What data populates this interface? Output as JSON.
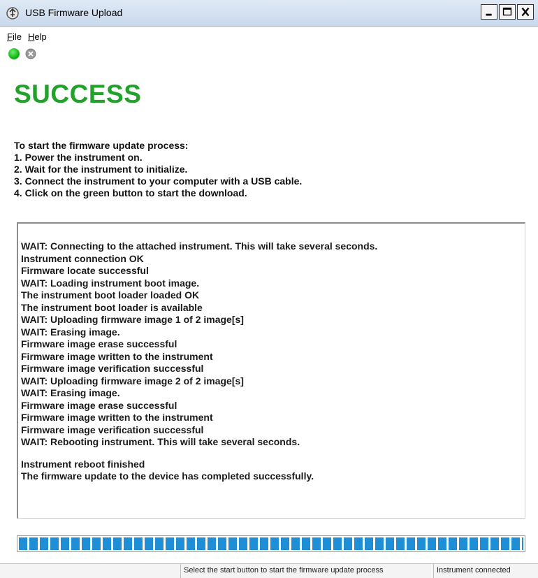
{
  "window": {
    "title": "USB Firmware Upload",
    "icon": "usb-firmware-app-icon",
    "buttons": {
      "minimize": "_",
      "maximize": "□",
      "close": "X"
    }
  },
  "menu": {
    "file": {
      "accel": "F",
      "rest": "ile"
    },
    "help": {
      "accel": "H",
      "rest": "elp"
    }
  },
  "toolbar": {
    "start": {
      "icon": "green-circle-start-icon",
      "color": "#14b414"
    },
    "stop": {
      "icon": "gray-x-circle-stop-icon",
      "color": "#8a8a8a"
    }
  },
  "status_heading": {
    "text": "SUCCESS",
    "color": "#22a22a"
  },
  "instructions": {
    "intro": "To start the firmware update process:",
    "steps": [
      "1. Power the instrument on.",
      "2. Wait for the instrument to initialize.",
      "3. Connect the instrument to your computer with a USB cable.",
      "4. Click on the green button to start the download."
    ]
  },
  "log": {
    "lines": [
      "WAIT: Connecting to the attached instrument. This will take several seconds.",
      "Instrument connection OK",
      "Firmware locate successful",
      "WAIT: Loading instrument boot image.",
      "The instrument boot loader loaded OK",
      "The instrument boot loader is available",
      "WAIT: Uploading firmware image 1 of 2 image[s]",
      "WAIT: Erasing image.",
      "Firmware image erase successful",
      "Firmware image written to the instrument",
      "Firmware image verification successful",
      "WAIT: Uploading firmware image 2 of 2 image[s]",
      "WAIT: Erasing image.",
      "Firmware image erase successful",
      "Firmware image written to the instrument",
      "Firmware image verification successful",
      "WAIT: Rebooting instrument. This will take several seconds."
    ],
    "final_lines": [
      "Instrument reboot finished",
      "The firmware update to the device has completed successfully."
    ]
  },
  "progress": {
    "percent": 100,
    "color": "#1e8fd6"
  },
  "statusbar": {
    "message": "Select the start button to start the firmware update process",
    "connection": "Instrument connected"
  }
}
